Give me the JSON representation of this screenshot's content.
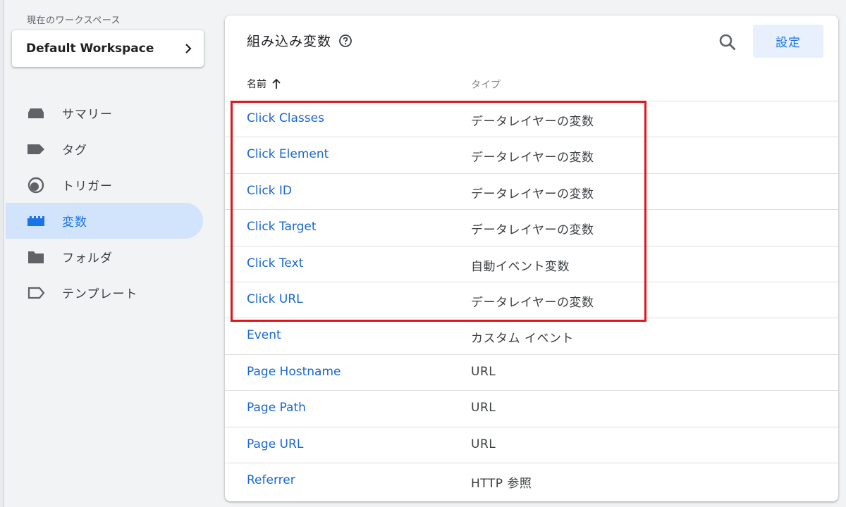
{
  "sidebar": {
    "workspace_label": "現在のワークスペース",
    "workspace_name": "Default Workspace",
    "items": [
      {
        "label": "サマリー",
        "icon": "summary-icon"
      },
      {
        "label": "タグ",
        "icon": "tag-icon"
      },
      {
        "label": "トリガー",
        "icon": "trigger-icon"
      },
      {
        "label": "変数",
        "icon": "variables-icon",
        "active": true
      },
      {
        "label": "フォルダ",
        "icon": "folder-icon"
      },
      {
        "label": "テンプレート",
        "icon": "template-icon"
      }
    ]
  },
  "main": {
    "title": "組み込み変数",
    "settings_label": "設定",
    "columns": {
      "name": "名前",
      "type": "タイプ"
    },
    "rows": [
      {
        "name": "Click Classes",
        "type": "データレイヤーの変数"
      },
      {
        "name": "Click Element",
        "type": "データレイヤーの変数"
      },
      {
        "name": "Click ID",
        "type": "データレイヤーの変数"
      },
      {
        "name": "Click Target",
        "type": "データレイヤーの変数"
      },
      {
        "name": "Click Text",
        "type": "自動イベント変数"
      },
      {
        "name": "Click URL",
        "type": "データレイヤーの変数"
      },
      {
        "name": "Event",
        "type": "カスタム イベント"
      },
      {
        "name": "Page Hostname",
        "type": "URL"
      },
      {
        "name": "Page Path",
        "type": "URL"
      },
      {
        "name": "Page URL",
        "type": "URL"
      },
      {
        "name": "Referrer",
        "type": "HTTP 参照"
      }
    ]
  },
  "colors": {
    "accent": "#1a73e8",
    "link": "#1967d2",
    "active_bg": "#d2e3fc",
    "highlight": "#e0161b"
  }
}
